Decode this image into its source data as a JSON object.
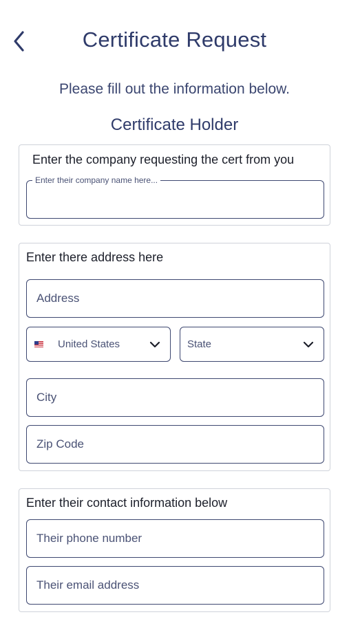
{
  "header": {
    "title": "Certificate Request",
    "back_icon": "chevron-left-icon"
  },
  "subtitle": "Please fill out the information below.",
  "section_heading": "Certificate Holder",
  "company_card": {
    "label": "Enter the company requesting the cert from you",
    "company_field": {
      "floating_label": "Enter their company name here...",
      "value": ""
    }
  },
  "address_card": {
    "label": "Enter there address here",
    "address_placeholder": "Address",
    "country": {
      "flag_icon": "us-flag-icon",
      "selected": "United States"
    },
    "state": {
      "selected": "State"
    },
    "city_placeholder": "City",
    "zip_placeholder": "Zip Code"
  },
  "contact_card": {
    "label": "Enter their contact information below",
    "phone_placeholder": "Their phone number",
    "email_placeholder": "Their email address"
  },
  "colors": {
    "title": "#2f3b6a",
    "field_border": "#3d4770",
    "card_border": "#cfd2da"
  }
}
